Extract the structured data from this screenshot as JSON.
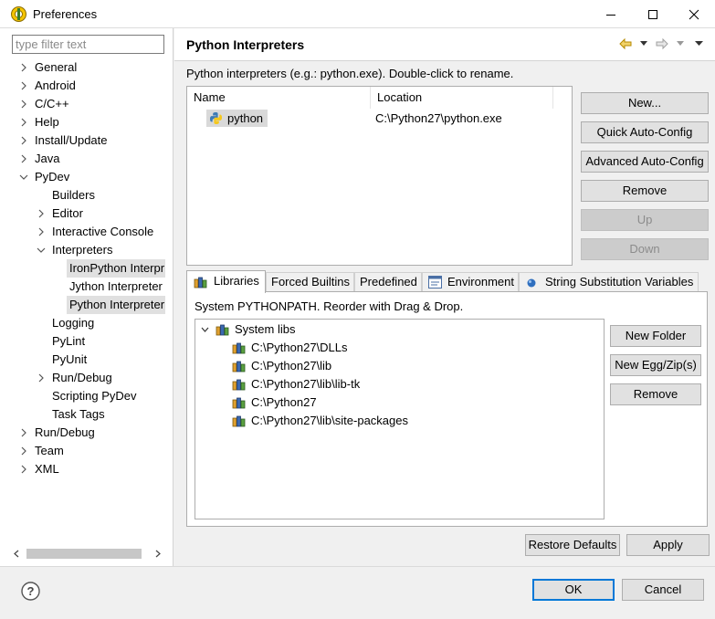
{
  "window": {
    "title": "Preferences"
  },
  "filter": {
    "placeholder": "type filter text"
  },
  "tree": {
    "items": [
      {
        "label": "General"
      },
      {
        "label": "Android"
      },
      {
        "label": "C/C++"
      },
      {
        "label": "Help"
      },
      {
        "label": "Install/Update"
      },
      {
        "label": "Java"
      },
      {
        "label": "PyDev"
      },
      {
        "label": "Builders"
      },
      {
        "label": "Editor"
      },
      {
        "label": "Interactive Console"
      },
      {
        "label": "Interpreters"
      },
      {
        "label": "IronPython Interpr"
      },
      {
        "label": "Jython Interpreter"
      },
      {
        "label": "Python Interpreter"
      },
      {
        "label": "Logging"
      },
      {
        "label": "PyLint"
      },
      {
        "label": "PyUnit"
      },
      {
        "label": "Run/Debug"
      },
      {
        "label": "Scripting PyDev"
      },
      {
        "label": "Task Tags"
      },
      {
        "label": "Run/Debug"
      },
      {
        "label": "Team"
      },
      {
        "label": "XML"
      }
    ]
  },
  "page": {
    "title": "Python Interpreters",
    "description": "Python interpreters (e.g.: python.exe).   Double-click to rename.",
    "table": {
      "columns": [
        "Name",
        "Location"
      ],
      "rows": [
        {
          "name": "python",
          "location": "C:\\Python27\\python.exe"
        }
      ]
    },
    "side_buttons": {
      "new": "New...",
      "quick_auto": "Quick Auto-Config",
      "advanced_auto": "Advanced Auto-Config",
      "remove": "Remove",
      "up": "Up",
      "down": "Down"
    },
    "tabs": [
      {
        "label": "Libraries",
        "active": true
      },
      {
        "label": "Forced Builtins"
      },
      {
        "label": "Predefined"
      },
      {
        "label": "Environment"
      },
      {
        "label": "String Substitution Variables"
      }
    ],
    "libraries": {
      "description": "System PYTHONPATH.   Reorder with Drag & Drop.",
      "root": "System libs",
      "paths": [
        "C:\\Python27\\DLLs",
        "C:\\Python27\\lib",
        "C:\\Python27\\lib\\lib-tk",
        "C:\\Python27",
        "C:\\Python27\\lib\\site-packages"
      ],
      "buttons": {
        "new_folder": "New Folder",
        "new_egg": "New Egg/Zip(s)",
        "remove": "Remove"
      }
    },
    "restore_defaults": "Restore Defaults",
    "apply": "Apply"
  },
  "footer": {
    "ok": "OK",
    "cancel": "Cancel",
    "help_glyph": "?"
  },
  "colors": {
    "focus_blue": "#0078d7",
    "selection_gray": "#d9d9d9"
  }
}
